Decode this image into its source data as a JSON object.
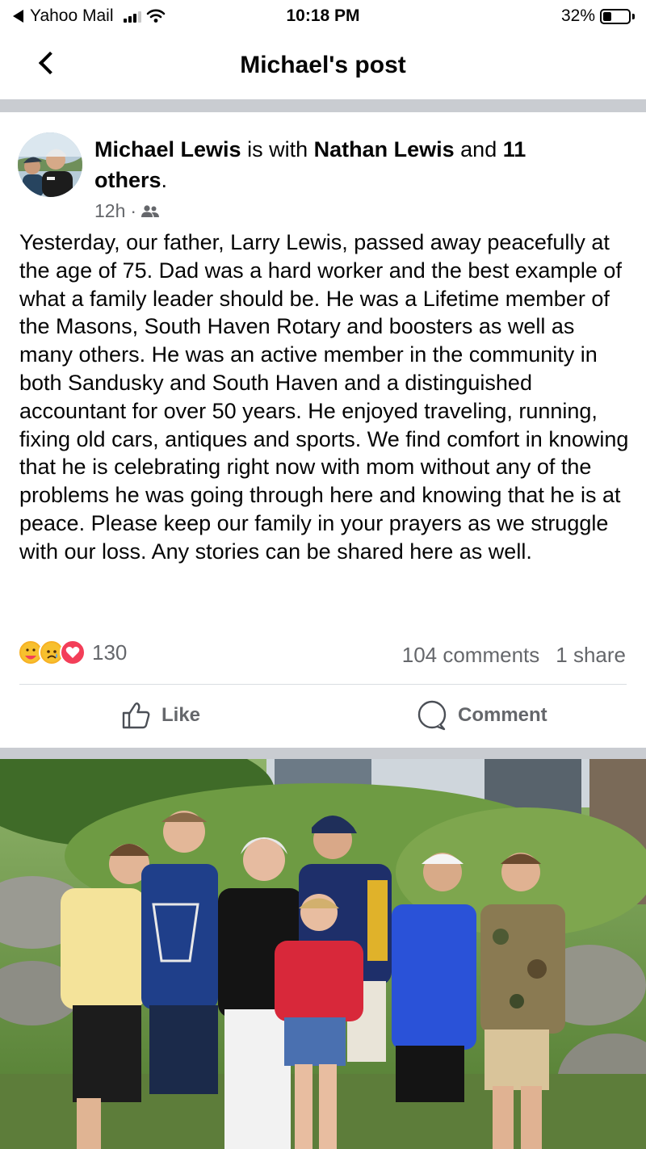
{
  "status_bar": {
    "back_app": "Yahoo Mail",
    "time": "10:18 PM",
    "battery": "32%",
    "battery_level": 0.32
  },
  "header": {
    "title": "Michael's post"
  },
  "post": {
    "author": "Michael Lewis",
    "with_text": " is with ",
    "tagged": "Nathan Lewis",
    "and_text": " and ",
    "others": "11 others",
    "period": ".",
    "time": "12h",
    "audience_icon": "friends-icon",
    "text": "Yesterday, our father, Larry Lewis, passed away peacefully at the age of 75. Dad was a hard worker and the best example of what a family leader should be. He was a Lifetime member of the Masons, South Haven Rotary and boosters as well as many others. He was an active member in the community in both Sandusky and South Haven and a distinguished accountant for over 50 years. He enjoyed traveling,  running, fixing old cars, antiques and sports. We find comfort in knowing that he is celebrating right now with mom without any of the problems he was going through here and knowing that he is at peace. Please keep our family in your prayers as we struggle with our loss. Any stories can be shared here as well.",
    "reaction_icons": [
      "care-reaction-icon",
      "sad-reaction-icon",
      "love-reaction-icon"
    ],
    "reaction_count": "130",
    "comments": "104 comments",
    "shares": "1 share"
  },
  "actions": {
    "like_label": "Like",
    "comment_label": "Comment"
  },
  "photo": {
    "description_icon": "family-photo"
  }
}
